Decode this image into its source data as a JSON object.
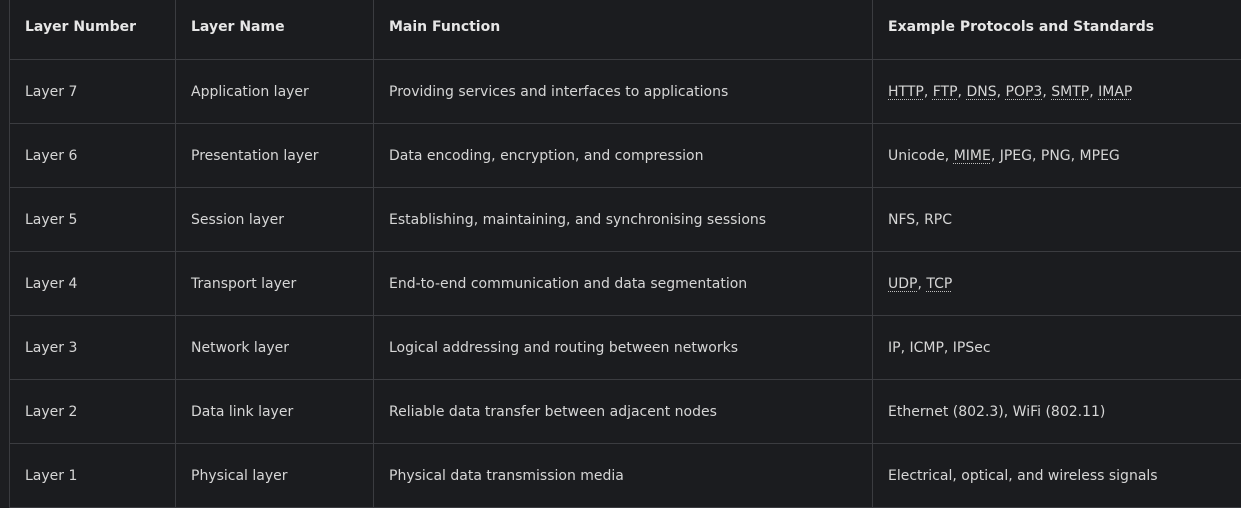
{
  "table": {
    "headers": [
      "Layer Number",
      "Layer Name",
      "Main Function",
      "Example Protocols and Standards"
    ],
    "rows": [
      {
        "number": "Layer 7",
        "name": "Application layer",
        "function": "Providing services and interfaces to applications",
        "protocols": [
          {
            "text": "HTTP",
            "abbr": true
          },
          {
            "text": ", ",
            "abbr": false
          },
          {
            "text": "FTP",
            "abbr": true
          },
          {
            "text": ", ",
            "abbr": false
          },
          {
            "text": "DNS",
            "abbr": true
          },
          {
            "text": ", ",
            "abbr": false
          },
          {
            "text": "POP3",
            "abbr": true
          },
          {
            "text": ", ",
            "abbr": false
          },
          {
            "text": "SMTP",
            "abbr": true
          },
          {
            "text": ", ",
            "abbr": false
          },
          {
            "text": "IMAP",
            "abbr": true
          }
        ]
      },
      {
        "number": "Layer 6",
        "name": "Presentation layer",
        "function": "Data encoding, encryption, and compression",
        "protocols": [
          {
            "text": "Unicode, ",
            "abbr": false
          },
          {
            "text": "MIME",
            "abbr": true
          },
          {
            "text": ", JPEG, PNG, MPEG",
            "abbr": false
          }
        ]
      },
      {
        "number": "Layer 5",
        "name": "Session layer",
        "function": "Establishing, maintaining, and synchronising sessions",
        "protocols": [
          {
            "text": "NFS, RPC",
            "abbr": false
          }
        ]
      },
      {
        "number": "Layer 4",
        "name": "Transport layer",
        "function": "End-to-end communication and data segmentation",
        "protocols": [
          {
            "text": "UDP",
            "abbr": true
          },
          {
            "text": ", ",
            "abbr": false
          },
          {
            "text": "TCP",
            "abbr": true
          }
        ]
      },
      {
        "number": "Layer 3",
        "name": "Network layer",
        "function": "Logical addressing and routing between networks",
        "protocols": [
          {
            "text": "IP, ICMP, IPSec",
            "abbr": false
          }
        ]
      },
      {
        "number": "Layer 2",
        "name": "Data link layer",
        "function": "Reliable data transfer between adjacent nodes",
        "protocols": [
          {
            "text": "Ethernet (802.3), WiFi (802.11)",
            "abbr": false
          }
        ]
      },
      {
        "number": "Layer 1",
        "name": "Physical layer",
        "function": "Physical data transmission media",
        "protocols": [
          {
            "text": "Electrical, optical, and wireless signals",
            "abbr": false
          }
        ]
      }
    ]
  }
}
